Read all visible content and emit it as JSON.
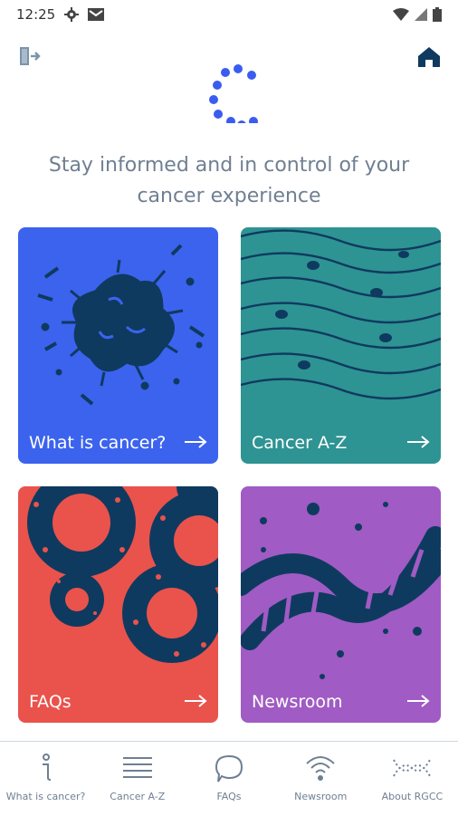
{
  "status_bar": {
    "time": "12:25",
    "icons": [
      "settings-icon",
      "mail-icon",
      "wifi-icon",
      "signal-icon",
      "battery-icon"
    ]
  },
  "header": {
    "exit_icon": "exit-door-icon",
    "home_icon": "home-icon"
  },
  "tagline": {
    "line1": "Stay informed and in control of your",
    "line2": "cancer experience"
  },
  "tiles": [
    {
      "label": "What is cancer?",
      "color": "#3b63ee",
      "icon": "cell-illustration"
    },
    {
      "label": "Cancer A-Z",
      "color": "#2e9393",
      "icon": "tissue-illustration"
    },
    {
      "label": "FAQs",
      "color": "#e9534c",
      "icon": "rings-illustration"
    },
    {
      "label": "Newsroom",
      "color": "#a05bc4",
      "icon": "dna-illustration"
    }
  ],
  "bottom_nav": [
    {
      "label": "What is cancer?",
      "icon": "info-icon"
    },
    {
      "label": "Cancer A-Z",
      "icon": "list-icon"
    },
    {
      "label": "FAQs",
      "icon": "chat-bubble-icon"
    },
    {
      "label": "Newsroom",
      "icon": "broadcast-icon"
    },
    {
      "label": "About RGCC",
      "icon": "dna-strand-icon"
    }
  ],
  "colors": {
    "navy": "#0f3a5f",
    "accent_blue": "#3b5cf0",
    "text_muted": "#6f7f92"
  }
}
